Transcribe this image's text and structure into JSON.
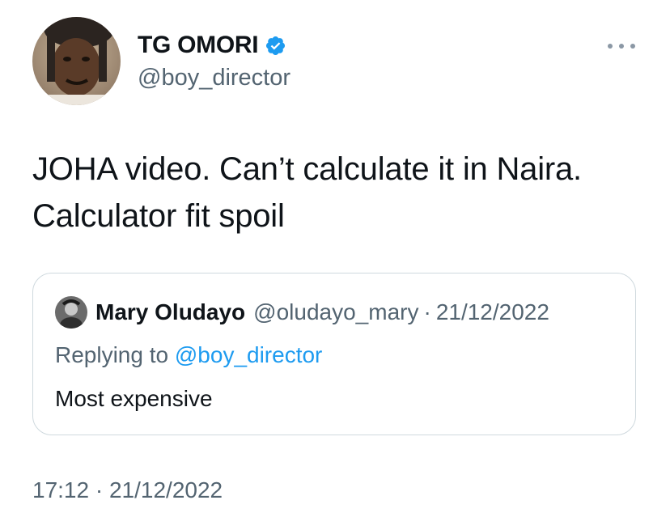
{
  "author": {
    "display_name": "TG OMORI",
    "handle": "@boy_director",
    "verified": true,
    "avatar_icon": "profile-photo"
  },
  "tweet": {
    "text": "JOHA video. Can’t calculate it in Naira. Calculator fit spoil"
  },
  "quoted_tweet": {
    "author_name": "Mary Oludayo",
    "author_handle": "@oludayo_mary",
    "separator": "·",
    "date": "21/12/2022",
    "replying_to_label": "Replying to",
    "replying_to_handle": "@boy_director",
    "text": "Most expensive"
  },
  "meta": {
    "time": "17:12",
    "separator": "·",
    "date": "21/12/2022"
  },
  "menu": {
    "more_icon": "more-horizontal-icon"
  },
  "colors": {
    "text_primary": "#0f1419",
    "text_secondary": "#536471",
    "link": "#1d9bf0",
    "verified": "#1d9bf0",
    "border": "#cfd9de"
  }
}
